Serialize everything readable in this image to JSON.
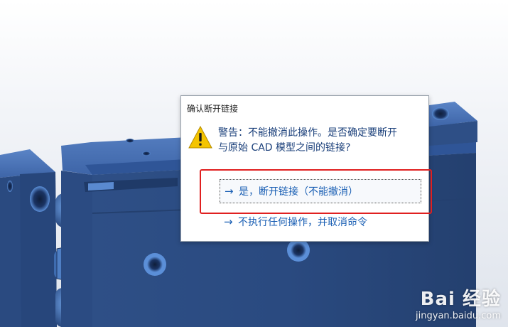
{
  "dialog": {
    "title": "确认断开链接",
    "warning_line1": "警告：不能撤消此操作。是否确定要断开",
    "warning_line2": "与原始 CAD 模型之间的链接?",
    "icon": "warning-icon",
    "commands": [
      {
        "label": "是，断开链接（不能撤消）",
        "icon": "arrow-right-icon"
      },
      {
        "label": "不执行任何操作，并取消命令",
        "icon": "arrow-right-icon"
      }
    ]
  },
  "watermark": {
    "logo": "Bai 经验",
    "url": "jingyan.baidu.com"
  },
  "colors": {
    "model_blue": "#2d4f86",
    "link_blue": "#1a5fb4",
    "highlight_red": "#e02020"
  }
}
